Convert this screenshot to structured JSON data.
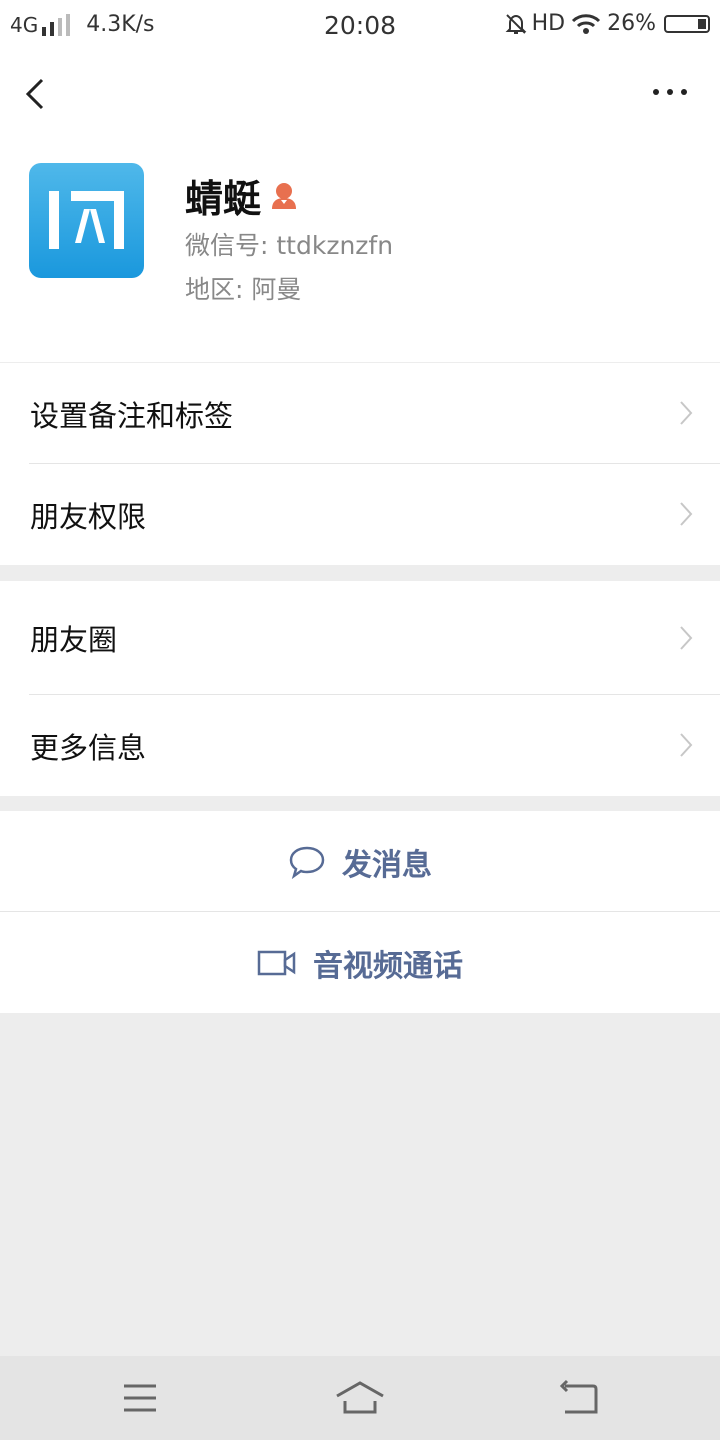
{
  "status_bar": {
    "network": "4G",
    "speed": "4.3K/s",
    "time": "20:08",
    "hd": "HD",
    "battery": "26%"
  },
  "profile": {
    "name": "蜻蜓",
    "wechat_id": "微信号: ttdkznzfn",
    "region": "地区: 阿曼",
    "gender": "female"
  },
  "menu_group1": [
    {
      "label": "设置备注和标签"
    },
    {
      "label": "朋友权限"
    }
  ],
  "menu_group2": [
    {
      "label": "朋友圈"
    },
    {
      "label": "更多信息"
    }
  ],
  "actions": {
    "message": "发消息",
    "video_call": "音视频通话"
  },
  "colors": {
    "accent": "#576b95",
    "avatar_blue": "#1a98dd",
    "gender_icon": "#e8704f"
  }
}
